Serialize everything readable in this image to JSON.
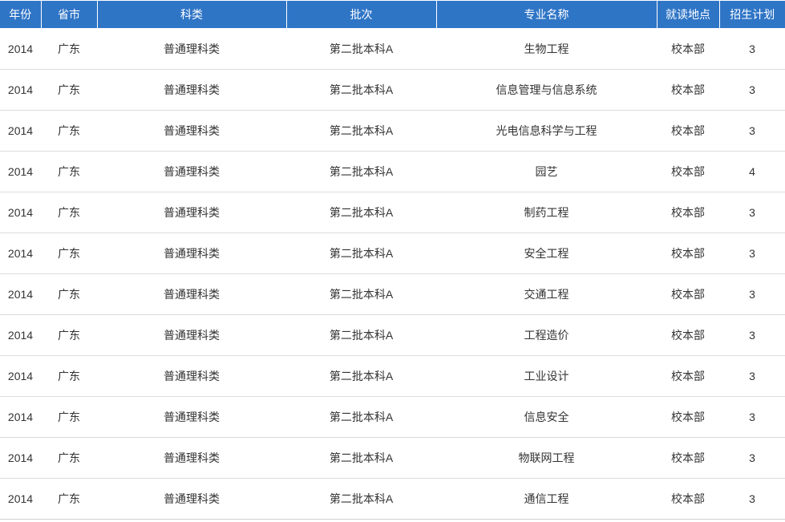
{
  "headers": {
    "year": "年份",
    "province": "省市",
    "category": "科类",
    "batch": "批次",
    "major": "专业名称",
    "location": "就读地点",
    "plan": "招生计划"
  },
  "rows": [
    {
      "year": "2014",
      "province": "广东",
      "category": "普通理科类",
      "batch": "第二批本科A",
      "major": "生物工程",
      "location": "校本部",
      "plan": "3"
    },
    {
      "year": "2014",
      "province": "广东",
      "category": "普通理科类",
      "batch": "第二批本科A",
      "major": "信息管理与信息系统",
      "location": "校本部",
      "plan": "3"
    },
    {
      "year": "2014",
      "province": "广东",
      "category": "普通理科类",
      "batch": "第二批本科A",
      "major": "光电信息科学与工程",
      "location": "校本部",
      "plan": "3"
    },
    {
      "year": "2014",
      "province": "广东",
      "category": "普通理科类",
      "batch": "第二批本科A",
      "major": "园艺",
      "location": "校本部",
      "plan": "4"
    },
    {
      "year": "2014",
      "province": "广东",
      "category": "普通理科类",
      "batch": "第二批本科A",
      "major": "制药工程",
      "location": "校本部",
      "plan": "3"
    },
    {
      "year": "2014",
      "province": "广东",
      "category": "普通理科类",
      "batch": "第二批本科A",
      "major": "安全工程",
      "location": "校本部",
      "plan": "3"
    },
    {
      "year": "2014",
      "province": "广东",
      "category": "普通理科类",
      "batch": "第二批本科A",
      "major": "交通工程",
      "location": "校本部",
      "plan": "3"
    },
    {
      "year": "2014",
      "province": "广东",
      "category": "普通理科类",
      "batch": "第二批本科A",
      "major": "工程造价",
      "location": "校本部",
      "plan": "3"
    },
    {
      "year": "2014",
      "province": "广东",
      "category": "普通理科类",
      "batch": "第二批本科A",
      "major": "工业设计",
      "location": "校本部",
      "plan": "3"
    },
    {
      "year": "2014",
      "province": "广东",
      "category": "普通理科类",
      "batch": "第二批本科A",
      "major": "信息安全",
      "location": "校本部",
      "plan": "3"
    },
    {
      "year": "2014",
      "province": "广东",
      "category": "普通理科类",
      "batch": "第二批本科A",
      "major": "物联网工程",
      "location": "校本部",
      "plan": "3"
    },
    {
      "year": "2014",
      "province": "广东",
      "category": "普通理科类",
      "batch": "第二批本科A",
      "major": "通信工程",
      "location": "校本部",
      "plan": "3"
    }
  ]
}
